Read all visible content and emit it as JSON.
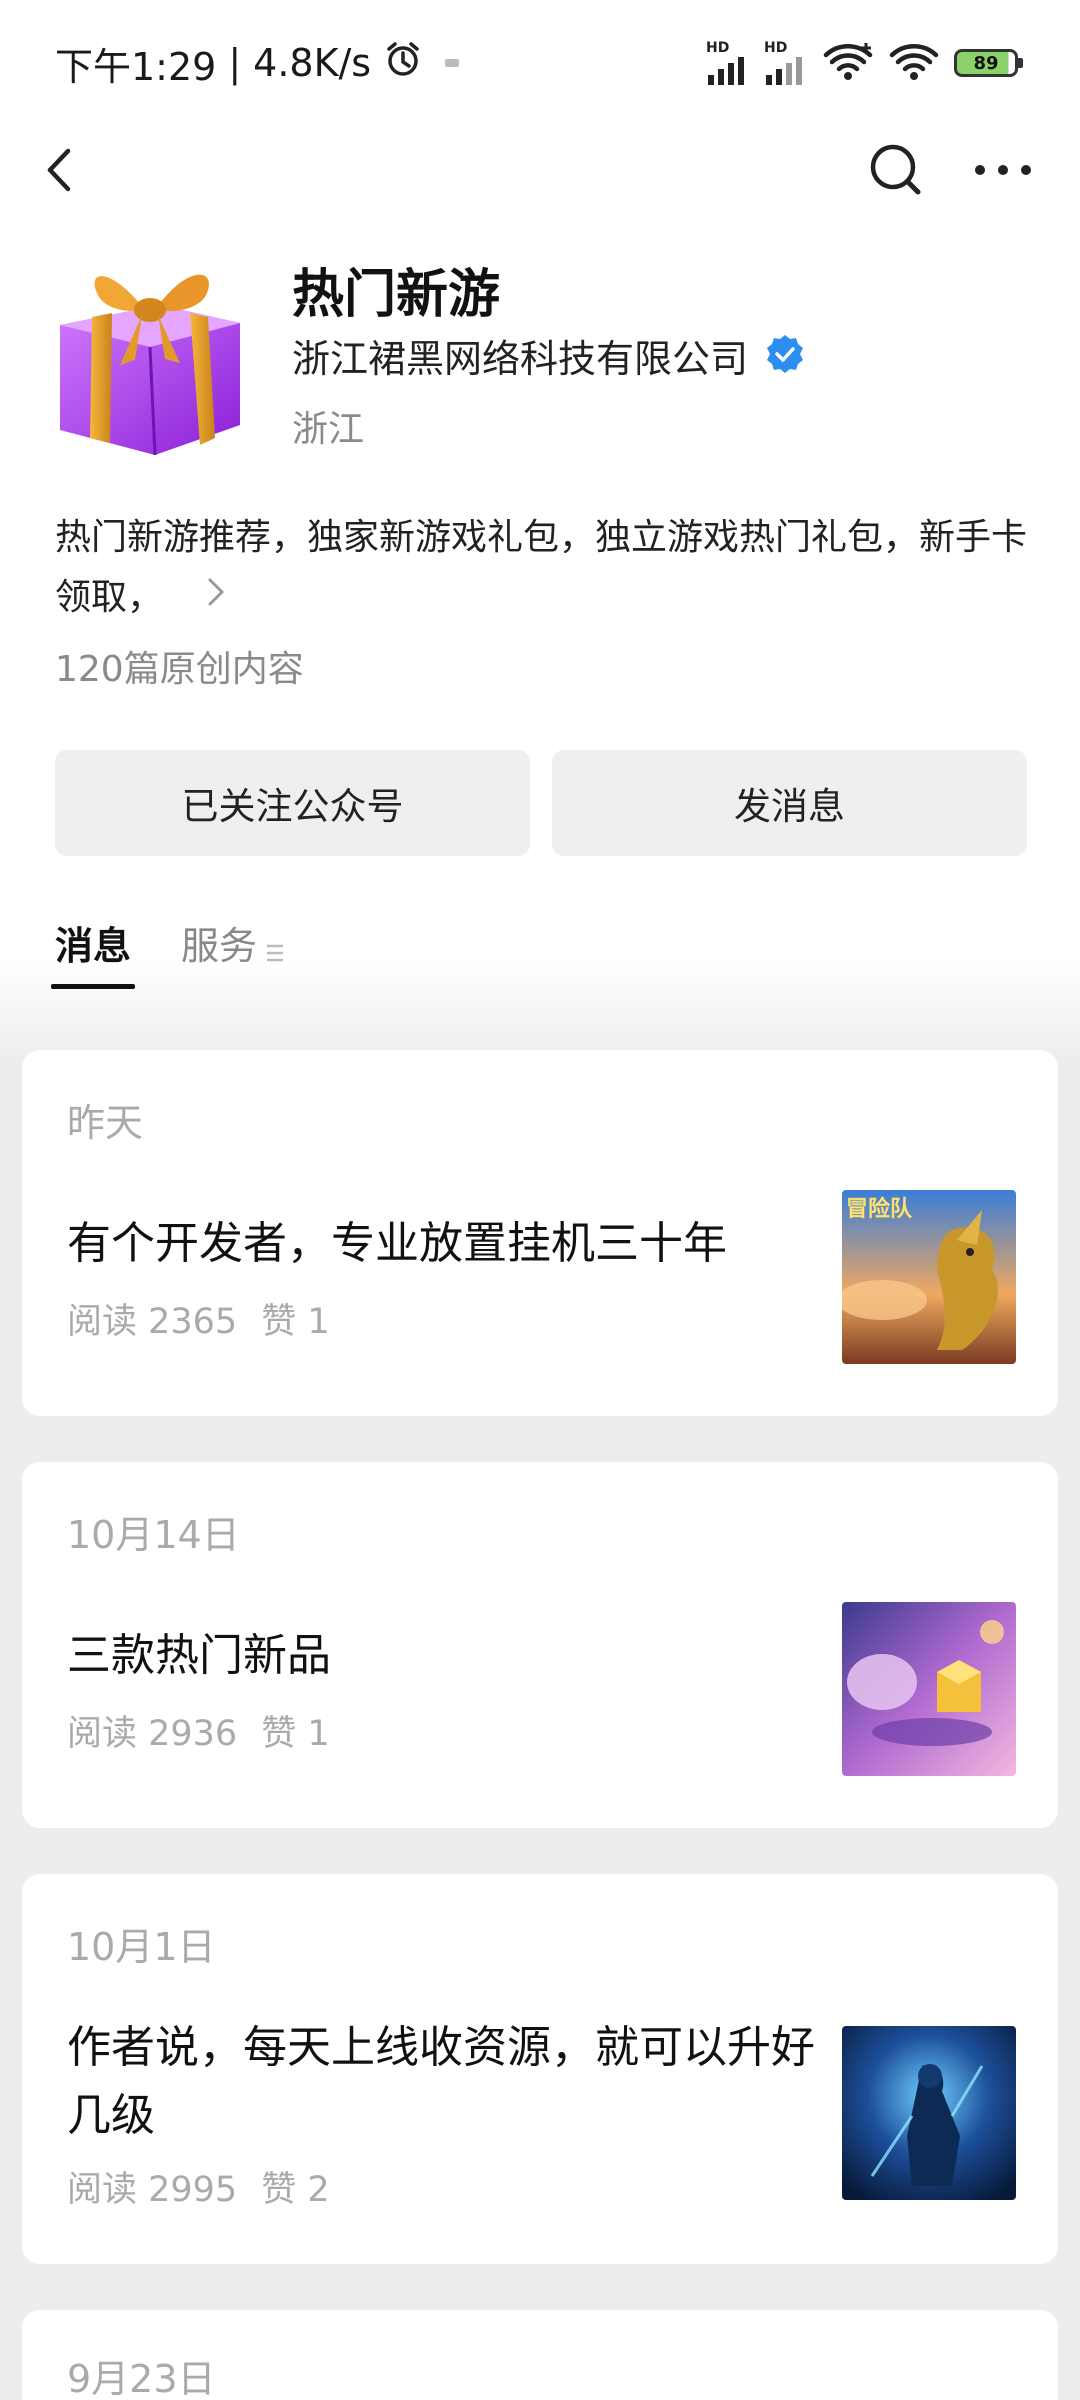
{
  "status_bar": {
    "time": "下午1:29",
    "separator": "|",
    "speed": "4.8K/s",
    "battery": "89",
    "icons": [
      "alarm-icon",
      "signal-hd-icon",
      "signal-hd-icon",
      "wifi-icon",
      "wifi-icon",
      "battery-icon"
    ]
  },
  "nav": {
    "icons": [
      "back-icon",
      "search-icon",
      "more-icon"
    ]
  },
  "profile": {
    "name": "热门新游",
    "company": "浙江裙黑网络科技有限公司",
    "region": "浙江",
    "description": "热门新游推荐，独家新游戏礼包，独立游戏热门礼包，新手卡领取，",
    "original_count": "120篇原创内容",
    "verified_color": "#2b8ef0"
  },
  "buttons": {
    "follow": "已关注公众号",
    "message": "发消息"
  },
  "tabs": [
    {
      "label": "消息",
      "active": true
    },
    {
      "label": "服务",
      "active": false
    }
  ],
  "articles": [
    {
      "date": "昨天",
      "title": "有个开发者，专业放置挂机三十年",
      "reads": "阅读 2365",
      "likes": "赞 1",
      "thumb_text": "冒险队"
    },
    {
      "date": "10月14日",
      "title": "三款热门新品",
      "reads": "阅读 2936",
      "likes": "赞 1"
    },
    {
      "date": "10月1日",
      "title": "作者说，每天上线收资源，就可以升好几级",
      "reads": "阅读 2995",
      "likes": "赞 2"
    },
    {
      "date": "9月23日"
    }
  ]
}
